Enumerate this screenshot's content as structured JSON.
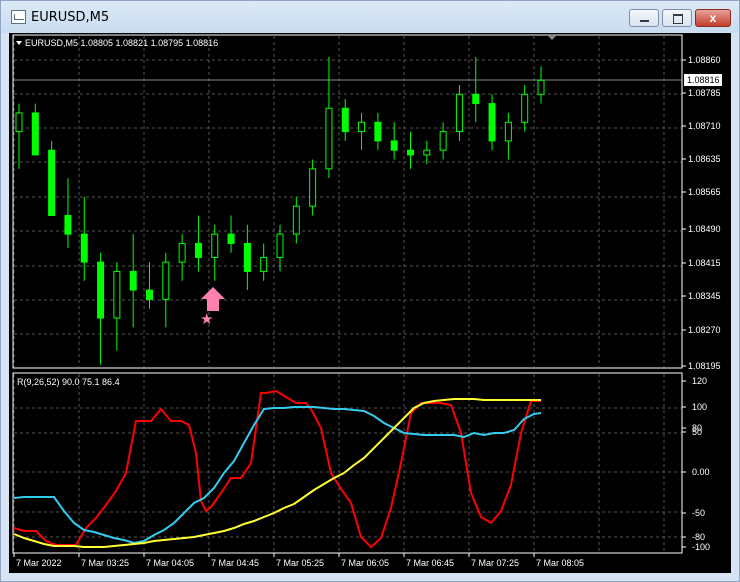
{
  "window": {
    "title": "EURUSD,M5",
    "close_glyph": "x",
    "icon": "chart-window-icon"
  },
  "price_chart": {
    "header": "EURUSD,M5  1.08805 1.08821 1.08795 1.08816",
    "current_price": "1.08816",
    "y_ticks": [
      "1.08860",
      "1.08785",
      "1.08710",
      "1.08635",
      "1.08565",
      "1.08490",
      "1.08415",
      "1.08345",
      "1.08270",
      "1.08195"
    ],
    "candle_color": "#00ff00",
    "background": "#000000",
    "arrow_color": "#ff7fb0",
    "signal_icons": [
      "up-arrow-icon",
      "star-icon"
    ]
  },
  "indicator": {
    "header": "R(9,26,52) 90.0 75.1 86.4",
    "y_ticks": [
      "120",
      "100",
      "80",
      "50",
      "0.00",
      "-50",
      "-80",
      "-100"
    ],
    "colors": {
      "red": "#ff0000",
      "cyan": "#33ccee",
      "yellow": "#ffff33"
    }
  },
  "x_axis": {
    "ticks": [
      "7 Mar 2022",
      "7 Mar 03:25",
      "7 Mar 04:05",
      "7 Mar 04:45",
      "7 Mar 05:25",
      "7 Mar 06:05",
      "7 Mar 06:45",
      "7 Mar 07:25",
      "7 Mar 08:05"
    ]
  },
  "chart_data": {
    "type": "candlestick",
    "symbol": "EURUSD,M5",
    "ylim": [
      1.08195,
      1.0889
    ],
    "ohlc_last": {
      "open": 1.08805,
      "high": 1.08821,
      "low": 1.08795,
      "close": 1.08816
    },
    "candles": [
      [
        1.087,
        1.0876,
        1.0862,
        1.0874
      ],
      [
        1.0874,
        1.0876,
        1.0865,
        1.0865
      ],
      [
        1.0866,
        1.0868,
        1.0852,
        1.0852
      ],
      [
        1.0852,
        1.086,
        1.0845,
        1.0848
      ],
      [
        1.0848,
        1.0856,
        1.0838,
        1.0842
      ],
      [
        1.0842,
        1.0844,
        1.082,
        1.083
      ],
      [
        1.083,
        1.0842,
        1.0823,
        1.084
      ],
      [
        1.084,
        1.0848,
        1.0828,
        1.0836
      ],
      [
        1.0836,
        1.0842,
        1.0832,
        1.0834
      ],
      [
        1.0834,
        1.0844,
        1.0828,
        1.0842
      ],
      [
        1.0842,
        1.0848,
        1.0838,
        1.0846
      ],
      [
        1.0846,
        1.0852,
        1.084,
        1.0843
      ],
      [
        1.0843,
        1.085,
        1.0838,
        1.0848
      ],
      [
        1.0848,
        1.0852,
        1.0844,
        1.0846
      ],
      [
        1.0846,
        1.085,
        1.0836,
        1.084
      ],
      [
        1.084,
        1.0846,
        1.0838,
        1.0843
      ],
      [
        1.0843,
        1.085,
        1.084,
        1.0848
      ],
      [
        1.0848,
        1.0856,
        1.0846,
        1.0854
      ],
      [
        1.0854,
        1.0864,
        1.0852,
        1.0862
      ],
      [
        1.0862,
        1.0886,
        1.086,
        1.0875
      ],
      [
        1.0875,
        1.0877,
        1.0868,
        1.087
      ],
      [
        1.087,
        1.0874,
        1.0866,
        1.0872
      ],
      [
        1.0872,
        1.0874,
        1.0866,
        1.0868
      ],
      [
        1.0868,
        1.0872,
        1.0864,
        1.0866
      ],
      [
        1.0866,
        1.087,
        1.0862,
        1.0865
      ],
      [
        1.0865,
        1.0868,
        1.0863,
        1.0866
      ],
      [
        1.0866,
        1.0872,
        1.0864,
        1.087
      ],
      [
        1.087,
        1.088,
        1.0868,
        1.0878
      ],
      [
        1.0878,
        1.0886,
        1.0872,
        1.0876
      ],
      [
        1.0876,
        1.0878,
        1.0866,
        1.0868
      ],
      [
        1.0868,
        1.0874,
        1.0864,
        1.0872
      ],
      [
        1.0872,
        1.088,
        1.087,
        1.0878
      ],
      [
        1.0878,
        1.0884,
        1.0876,
        1.0881
      ]
    ]
  }
}
